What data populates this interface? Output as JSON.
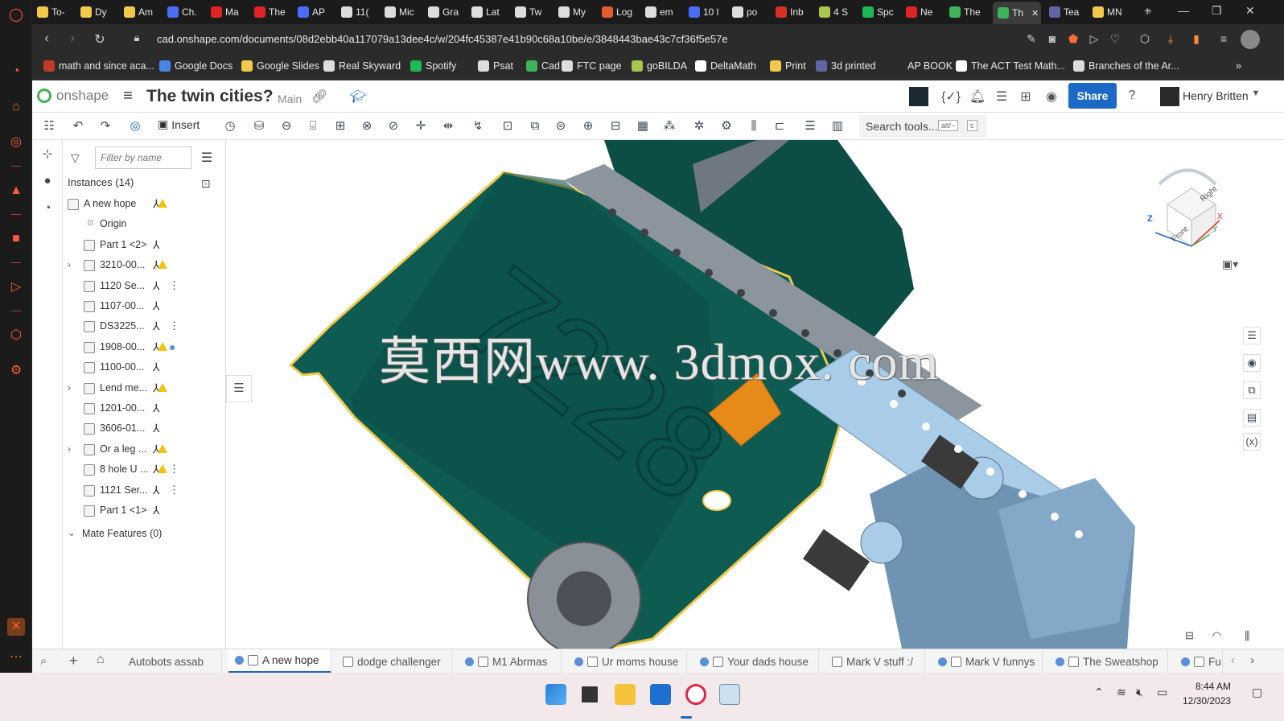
{
  "browser": {
    "tabs": [
      {
        "label": "To-",
        "color": "#f2c94c"
      },
      {
        "label": "Dy",
        "color": "#f2c94c"
      },
      {
        "label": "Am",
        "color": "#f2c94c"
      },
      {
        "label": "Ch.",
        "color": "#4a6cf7"
      },
      {
        "label": "Ma",
        "color": "#e02424"
      },
      {
        "label": "The",
        "color": "#e02424"
      },
      {
        "label": "AP",
        "color": "#4a6cf7"
      },
      {
        "label": "11(",
        "color": "#dddddd"
      },
      {
        "label": "Mic",
        "color": "#dddddd"
      },
      {
        "label": "Gra",
        "color": "#dddddd"
      },
      {
        "label": "Lat",
        "color": "#dddddd"
      },
      {
        "label": "Tw",
        "color": "#dddddd"
      },
      {
        "label": "My",
        "color": "#dddddd"
      },
      {
        "label": "Log",
        "color": "#e25d2b"
      },
      {
        "label": "em",
        "color": "#dddddd"
      },
      {
        "label": "10 l",
        "color": "#4a6cf7"
      },
      {
        "label": "po",
        "color": "#dddddd"
      },
      {
        "label": "Inb",
        "color": "#d93025"
      },
      {
        "label": "4 S",
        "color": "#a8c64e"
      },
      {
        "label": "Spc",
        "color": "#1db954"
      },
      {
        "label": "Ne",
        "color": "#e02424"
      },
      {
        "label": "The",
        "color": "#3eb35a"
      },
      {
        "label": "Th",
        "color": "#3eb35a",
        "active": true
      },
      {
        "label": "Tea",
        "color": "#6264a7"
      },
      {
        "label": "MN",
        "color": "#f2c94c"
      }
    ],
    "url": "cad.onshape.com/documents/08d2ebb40a117079a13dee4c/w/204fc45387e41b90c68a10be/e/3848443bae43c7cf36f5e57e",
    "bookmarks": [
      {
        "label": "math and since aca...",
        "color": "#c0392b"
      },
      {
        "label": "Google Docs",
        "color": "#4a86e8"
      },
      {
        "label": "Google Slides",
        "color": "#f2c94c"
      },
      {
        "label": "Real Skyward",
        "color": "#dddddd"
      },
      {
        "label": "Spotify",
        "color": "#1db954"
      },
      {
        "label": "Psat",
        "color": "#dddddd"
      },
      {
        "label": "Cad",
        "color": "#3eb35a"
      },
      {
        "label": "FTC page",
        "color": "#dddddd"
      },
      {
        "label": "goBILDA",
        "color": "#a8c64e"
      },
      {
        "label": "DeltaMath",
        "color": "#ffffff"
      },
      {
        "label": "Print",
        "color": "#f2c94c"
      },
      {
        "label": "3d printed",
        "color": "#6264a7"
      },
      {
        "label": "AP BOOK",
        "color": ""
      },
      {
        "label": "The ACT Test Math...",
        "color": "#ffffff"
      },
      {
        "label": "Branches of the Ar...",
        "color": "#dddddd"
      }
    ]
  },
  "onshape": {
    "logo_text": "onshape",
    "doc_title": "The twin cities?",
    "branch": "Main",
    "share_label": "Share",
    "user_name": "Henry Britten",
    "toolbar": {
      "insert_label": "Insert",
      "search_label": "Search tools...",
      "search_kbd1": "alt/~",
      "search_kbd2": "c"
    },
    "panel": {
      "filter_placeholder": "Filter by name",
      "instances_header": "Instances (14)",
      "items": [
        {
          "label": "A new hope",
          "indent": 0,
          "expandable": false,
          "warn": true,
          "mate": true,
          "extra": ""
        },
        {
          "label": "Origin",
          "indent": 1,
          "expandable": false,
          "warn": false,
          "mate": false,
          "extra": "",
          "origin": true
        },
        {
          "label": "Part 1 <2>",
          "indent": 1,
          "expandable": false,
          "warn": false,
          "mate": true,
          "extra": ""
        },
        {
          "label": "3210-00...",
          "indent": 1,
          "expandable": true,
          "warn": true,
          "mate": true,
          "extra": ""
        },
        {
          "label": "1120 Se...",
          "indent": 1,
          "expandable": false,
          "warn": false,
          "mate": true,
          "extra": "⋮"
        },
        {
          "label": "1107-00...",
          "indent": 1,
          "expandable": false,
          "warn": false,
          "mate": true,
          "extra": ""
        },
        {
          "label": "DS3225...",
          "indent": 1,
          "expandable": false,
          "warn": false,
          "mate": true,
          "extra": "⋮"
        },
        {
          "label": "1908-00...",
          "indent": 1,
          "expandable": false,
          "warn": true,
          "mate": true,
          "extra": "●"
        },
        {
          "label": "1100-00...",
          "indent": 1,
          "expandable": false,
          "warn": false,
          "mate": true,
          "extra": ""
        },
        {
          "label": "Lend me...",
          "indent": 1,
          "expandable": true,
          "warn": true,
          "mate": true,
          "extra": ""
        },
        {
          "label": "1201-00...",
          "indent": 1,
          "expandable": false,
          "warn": false,
          "mate": true,
          "extra": ""
        },
        {
          "label": "3606-01...",
          "indent": 1,
          "expandable": false,
          "warn": false,
          "mate": true,
          "extra": ""
        },
        {
          "label": "Or a leg ...",
          "indent": 1,
          "expandable": true,
          "warn": true,
          "mate": true,
          "extra": ""
        },
        {
          "label": "8 hole U ...",
          "indent": 1,
          "expandable": false,
          "warn": true,
          "mate": true,
          "extra": "⋮"
        },
        {
          "label": "1121 Ser...",
          "indent": 1,
          "expandable": false,
          "warn": false,
          "mate": true,
          "extra": "⋮"
        },
        {
          "label": "Part 1 <1>",
          "indent": 1,
          "expandable": false,
          "warn": false,
          "mate": true,
          "extra": ""
        }
      ],
      "mate_features_label": "Mate Features (0)"
    },
    "viewport": {
      "watermark": "莫西网www. 3dmox. com",
      "model_colors": {
        "plate": "#0e5b52",
        "plate_edge": "#f2c94c",
        "channel": "#9aa3ab",
        "light_channel": "#a9cde8",
        "orange": "#e88a1a"
      },
      "viewcube_labels": {
        "front": "Front",
        "right": "Right",
        "z": "Z",
        "x": "X",
        "y": "Y"
      }
    },
    "bottom_tabs": [
      {
        "label": "Autobots assab",
        "kind": "plain"
      },
      {
        "label": "A new hope",
        "kind": "assembly",
        "active": true
      },
      {
        "label": "dodge challenger",
        "kind": "part"
      },
      {
        "label": "M1 Abrmas",
        "kind": "assembly"
      },
      {
        "label": "Ur moms house",
        "kind": "assembly"
      },
      {
        "label": "Your dads house",
        "kind": "assembly"
      },
      {
        "label": "Mark V stuff :/",
        "kind": "part"
      },
      {
        "label": "Mark V funnys",
        "kind": "assembly"
      },
      {
        "label": "The Sweatshop",
        "kind": "assembly"
      },
      {
        "label": "Fu",
        "kind": "assembly"
      }
    ]
  },
  "taskbar": {
    "time": "8:44 AM",
    "date": "12/30/2023"
  }
}
